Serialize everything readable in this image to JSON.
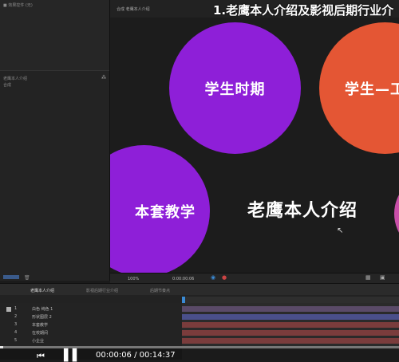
{
  "overlay_title": "1.老鹰本人介绍及影视后期行业介",
  "viewer": {
    "tab_label": "合成 老鹰本人介绍",
    "circles": [
      {
        "label": "学生时期",
        "color": "#8e1fd8"
      },
      {
        "label": "学生—工",
        "color": "#e45634"
      },
      {
        "label": "本套教学",
        "color": "#8e1fd8"
      },
      {
        "label": "",
        "color": "#c94fa9"
      }
    ],
    "center_text": "老鹰本人介绍",
    "zoom": "100%",
    "timecode": "0:00:00:06"
  },
  "project_panel": {
    "item1": "老鹰本人介绍",
    "item2": "合成"
  },
  "timeline": {
    "tabs": [
      "老鹰本人介绍",
      "影视后期行业介绍",
      "后期节奏点"
    ],
    "layers": [
      {
        "num": "1",
        "name": "白色 纯色 1",
        "color": "#b0b0b0"
      },
      {
        "num": "2",
        "name": "形状图层 2",
        "color": "#5a62c8"
      },
      {
        "num": "3",
        "name": "本套教学",
        "color": "#c04040"
      },
      {
        "num": "4",
        "name": "在校期间",
        "color": "#c04040"
      },
      {
        "num": "5",
        "name": "小企业",
        "color": "#c04040"
      }
    ],
    "track_colors": [
      "#5a4a68",
      "#4a4f8a",
      "#7a3c3c",
      "#7a3c3c",
      "#7a3c3c"
    ]
  },
  "player": {
    "time": "00:00:06 / 00:14:37",
    "progress": 0.007
  }
}
